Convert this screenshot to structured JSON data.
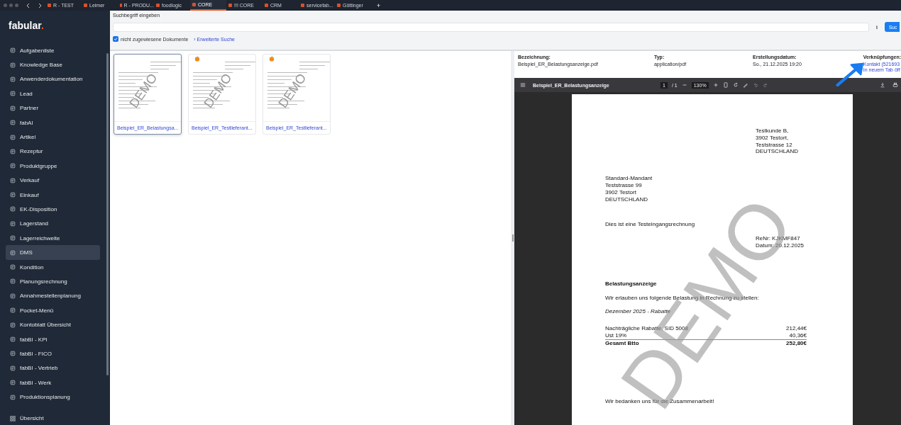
{
  "browser_tabs": [
    {
      "label": "R - TEST",
      "selected": false
    },
    {
      "label": "Leimer",
      "selected": false
    },
    {
      "label": "R - PRODU...",
      "selected": false
    },
    {
      "label": "foodlogic",
      "selected": false
    },
    {
      "label": "CORE",
      "selected": true
    },
    {
      "label": "!!! CORE",
      "selected": false
    },
    {
      "label": "CRM",
      "selected": false
    },
    {
      "label": "servicefab...",
      "selected": false
    },
    {
      "label": "Göttinger",
      "selected": false
    }
  ],
  "new_tab": "+",
  "sidebar": {
    "logo": "fabular",
    "logo_dot": ".",
    "items": [
      {
        "label": "Aufgabenliste",
        "selected": false
      },
      {
        "label": "Knowledge Base",
        "selected": false
      },
      {
        "label": "Anwenderdokumentation",
        "selected": false
      },
      {
        "label": "Lead",
        "selected": false
      },
      {
        "label": "Partner",
        "selected": false
      },
      {
        "label": "fabAI",
        "selected": false
      },
      {
        "label": "Artikel",
        "selected": false
      },
      {
        "label": "Rezeptur",
        "selected": false
      },
      {
        "label": "Produktgruppe",
        "selected": false
      },
      {
        "label": "Verkauf",
        "selected": false
      },
      {
        "label": "Einkauf",
        "selected": false
      },
      {
        "label": "EK-Disposition",
        "selected": false
      },
      {
        "label": "Lagerstand",
        "selected": false
      },
      {
        "label": "Lagerreichweite",
        "selected": false
      },
      {
        "label": "DMS",
        "selected": true
      },
      {
        "label": "Kondition",
        "selected": false
      },
      {
        "label": "Planungsrechnung",
        "selected": false
      },
      {
        "label": "Annahmestellenplanung",
        "selected": false
      },
      {
        "label": "Pocket-Menü",
        "selected": false
      },
      {
        "label": "Kontoblatt Übersicht",
        "selected": false
      },
      {
        "label": "fabBI - KPI",
        "selected": false
      },
      {
        "label": "fabBI - FICO",
        "selected": false
      },
      {
        "label": "fabBI - Vertrieb",
        "selected": false
      },
      {
        "label": "fabBI - Werk",
        "selected": false
      },
      {
        "label": "Produktionsplanung",
        "selected": false
      }
    ],
    "footer_item": {
      "label": "Übersicht",
      "selected": false
    }
  },
  "search": {
    "label": "Suchbegriff eingeben",
    "info": "i",
    "button": "Suc",
    "unassigned_checkbox": {
      "label": "nicht zugewiesene Dokumente",
      "checked": true
    },
    "advanced_chevron": "›",
    "advanced_link": "Erweiterte Suche"
  },
  "documents": [
    {
      "name": "Beispiel_ER_Belastungsa...",
      "watermark": "DEMO",
      "selected": true,
      "logo": false
    },
    {
      "name": "Beispiel_ER_Testlieferant...",
      "watermark": "DEMO",
      "selected": false,
      "logo": true
    },
    {
      "name": "Beispiel_ER_Testlieferant...",
      "watermark": "DEMO",
      "selected": false,
      "logo": true
    }
  ],
  "details": {
    "fields": [
      {
        "label": "Bezeichnung:",
        "value": "Beispiel_ER_Belastungsanzeige.pdf"
      },
      {
        "label": "Typ:",
        "value": "application/pdf"
      },
      {
        "label": "Erstellungsdatum:",
        "value": "So., 21.12.2025 19:20"
      }
    ],
    "links_label": "Verknüpfungen:",
    "links": [
      "Kontakt (521693",
      "In neuem Tab öff"
    ]
  },
  "pdf_viewer": {
    "title": "Beispiel_ER_Belastungsanzeige",
    "page": "1",
    "page_total": "/ 1",
    "zoom": "130%",
    "document": {
      "recipient": [
        "Testkunde B,",
        "3902 Testort,",
        "Teststrasse 12",
        "DEUTSCHLAND"
      ],
      "sender": [
        "Standard-Mandant",
        "Teststrasse 99",
        "3902 Testort",
        "DEUTSCHLAND"
      ],
      "intro": "Dies ist eine Testeingangsrechnung",
      "invoice_meta": [
        "ReNr: KJKMF847",
        "Datum: 20.12.2025"
      ],
      "heading": "Belastungsanzeige",
      "text": "Wir erlauben uns folgende Belastung in Rechnung zu stellen:",
      "period": "Dezember 2025 - Rabatte",
      "lines": [
        {
          "label": "Nachträgliche Rabatte, SID 5008",
          "amount": "212,44€",
          "kind": "item"
        },
        {
          "label": "Ust 19%",
          "amount": "40,36€",
          "kind": "item"
        },
        {
          "label": "Gesamt Btto",
          "amount": "252,80€",
          "kind": "total"
        }
      ],
      "closing": "Wir bedanken uns für die Zusammenarbeit!",
      "watermark": "DEMO"
    }
  }
}
